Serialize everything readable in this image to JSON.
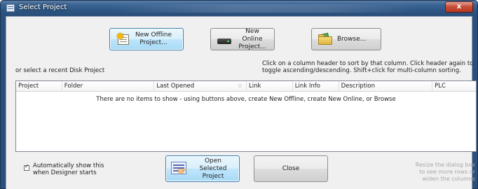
{
  "window": {
    "title": "Select Project",
    "close_glyph": "x"
  },
  "top_buttons": {
    "new_offline": {
      "line1": "New Offline",
      "line2": "Project...",
      "icon": "new-project-star-icon"
    },
    "new_online": {
      "line1": "New Online",
      "line2": "Project...",
      "icon": "online-drive-icon"
    },
    "browse": {
      "label": "Browse...",
      "icon": "open-folder-icon"
    }
  },
  "recent_label": "or select a recent Disk Project",
  "sort_hint": {
    "line1": "Click on a column header to sort by that column. Click header again to",
    "line2": "toggle ascending/descending. Shift+click for multi-column sorting."
  },
  "table": {
    "columns": [
      "Project",
      "Folder",
      "Last Opened",
      "Link",
      "Link Info",
      "Description",
      "PLC"
    ],
    "sort_indicator": "▽",
    "empty_message": "There are no items to show - using buttons above, create New Offline, create New Online, or Browse"
  },
  "auto_show": {
    "checked": true,
    "line1": "Automatically show this",
    "line2": "when Designer starts"
  },
  "bottom_buttons": {
    "open_selected": {
      "line1": "Open Selected",
      "line2": "Project"
    },
    "close": "Close"
  },
  "resize_hint": "Resize the dialog box\nto see more rows or\nwiden the columns",
  "colors": {
    "title_bar": "#2d5683",
    "close_button": "#c9503b",
    "default_button": "#bee6fd",
    "dialog_bg": "#f0f0f0"
  }
}
